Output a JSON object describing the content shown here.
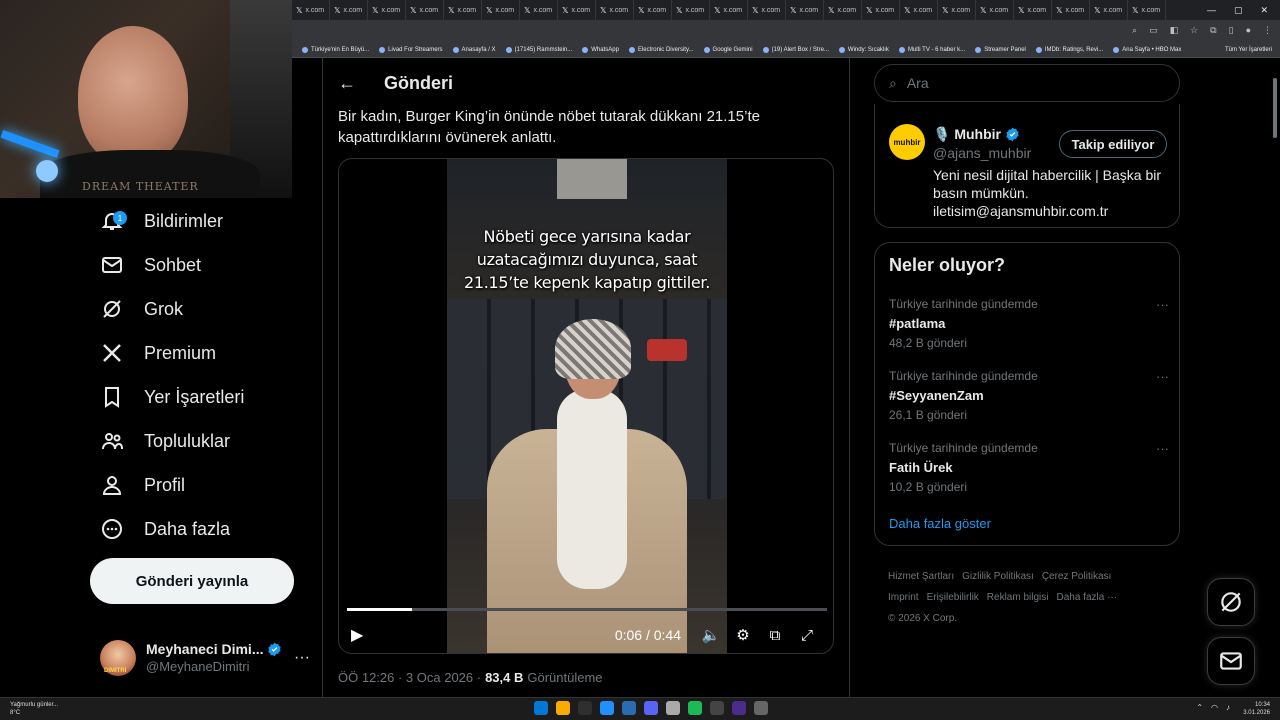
{
  "browser": {
    "tab_labels": [
      "x.com",
      "x.com",
      "x.com",
      "x.com",
      "x.com",
      "x.com",
      "x.com",
      "x.com",
      "x.com",
      "x.com",
      "x.com",
      "x.com",
      "x.com",
      "x.com",
      "x.com",
      "x.com",
      "x.com",
      "x.com",
      "x.com",
      "x.com",
      "x.com",
      "x.com",
      "x.com"
    ],
    "bookmarks": [
      "Türkiye'nin En Büyü...",
      "Livad For Streamers",
      "Anasayfa / X",
      "(17145) Rammstein...",
      "WhatsApp",
      "Electronic Diversity...",
      "Google Gemini",
      "(19) Alert Box / Stre...",
      "Windy: Sıcaklık",
      "Multi TV - 6 haber k...",
      "Streamer Panel",
      "IMDb: Ratings, Revi...",
      "Ana Sayfa • HBO Max"
    ],
    "bookmarks_right": "Tüm Yer İşaretleri"
  },
  "webcam": {
    "logo_text": "DREAM THEATER"
  },
  "nav": {
    "items": [
      {
        "label": "Bildirimler",
        "icon": "bell-icon",
        "badge": "1"
      },
      {
        "label": "Sohbet",
        "icon": "mail-icon"
      },
      {
        "label": "Grok",
        "icon": "grok-icon"
      },
      {
        "label": "Premium",
        "icon": "x-logo-icon"
      },
      {
        "label": "Yer İşaretleri",
        "icon": "bookmark-icon"
      },
      {
        "label": "Topluluklar",
        "icon": "people-icon"
      },
      {
        "label": "Profil",
        "icon": "person-icon"
      },
      {
        "label": "Daha fazla",
        "icon": "more-circle-icon"
      }
    ],
    "post_button": "Gönderi yayınla",
    "account": {
      "name": "Meyhaneci Dimi...",
      "handle": "@MeyhaneDimitri",
      "avatar_text": "DIMITRI"
    }
  },
  "post": {
    "header_title": "Gönderi",
    "text": "Bir kadın, Burger King’in önünde nöbet tutarak dükkanı 21.15’te kapattırdıklarını övünerek anlattı.",
    "video": {
      "caption": "Nöbeti gece yarısına kadar uzatacağımızı duyunca, saat 21.15’te kepenk kapatıp gittiler.",
      "time": "0:06 / 0:44",
      "progress": 0.136
    },
    "timestamp": "ÖÖ 12:26 · 3 Oca 2026 ·",
    "views_count": "83,4 B",
    "views_label": "Görüntüleme"
  },
  "sidebar": {
    "search_placeholder": "Ara",
    "profile": {
      "logo_text": "muhbir",
      "name": "🎙️ Muhbir",
      "handle": "@ajans_muhbir",
      "follow_label": "Takip ediliyor",
      "bio": "Yeni nesil dijital habercilik | Başka bir basın mümkün. iletisim@ajansmuhbir.com.tr"
    },
    "trends_title": "Neler oluyor?",
    "trends": [
      {
        "context": "Türkiye tarihinde gündemde",
        "name": "#patlama",
        "count": "48,2 B gönderi"
      },
      {
        "context": "Türkiye tarihinde gündemde",
        "name": "#SeyyanenZam",
        "count": "26,1 B gönderi"
      },
      {
        "context": "Türkiye tarihinde gündemde",
        "name": "Fatih Ürek",
        "count": "10,2 B gönderi"
      }
    ],
    "show_more": "Daha fazla göster",
    "footer": [
      "Hizmet Şartları",
      "Gizlilik Politikası",
      "Çerez Politikası",
      "Imprint",
      "Erişilebilirlik",
      "Reklam bilgisi",
      "Daha fazla ···",
      "© 2026 X Corp."
    ]
  },
  "taskbar": {
    "weather": "Yağmurlu günler...",
    "weather_temp": "8°C",
    "time": "10:34",
    "date": "3.01.2026"
  },
  "colors": {
    "accent": "#1d9bf0",
    "background": "#000000",
    "border": "#2f3336",
    "muted": "#71767b"
  }
}
